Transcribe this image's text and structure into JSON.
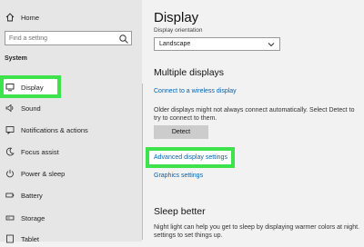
{
  "sidebar": {
    "home": "Home",
    "search_placeholder": "Find a setting",
    "section": "System",
    "items": [
      {
        "label": "Display",
        "icon": "monitor-icon"
      },
      {
        "label": "Sound",
        "icon": "speaker-icon"
      },
      {
        "label": "Notifications & actions",
        "icon": "notifications-icon"
      },
      {
        "label": "Focus assist",
        "icon": "moon-icon"
      },
      {
        "label": "Power & sleep",
        "icon": "power-icon"
      },
      {
        "label": "Battery",
        "icon": "battery-icon"
      },
      {
        "label": "Storage",
        "icon": "storage-icon"
      },
      {
        "label": "Tablet",
        "icon": "tablet-icon"
      }
    ]
  },
  "main": {
    "title": "Display",
    "orientation_label": "Display orientation",
    "orientation_value": "Landscape",
    "multiple_displays_heading": "Multiple displays",
    "connect_link": "Connect to a wireless display",
    "detect_text_line1": "Older displays might not always connect automatically. Select Detect to",
    "detect_text_line2": "try to connect to them.",
    "detect_button": "Detect",
    "advanced_link": "Advanced display settings",
    "graphics_link": "Graphics settings",
    "sleep_heading": "Sleep better",
    "sleep_text_line1": "Night light can help you get to sleep by displaying warmer colors at night.",
    "sleep_text_line2": "settings to set things up."
  },
  "colors": {
    "highlight": "#3ee24a",
    "link": "#0063b1"
  }
}
